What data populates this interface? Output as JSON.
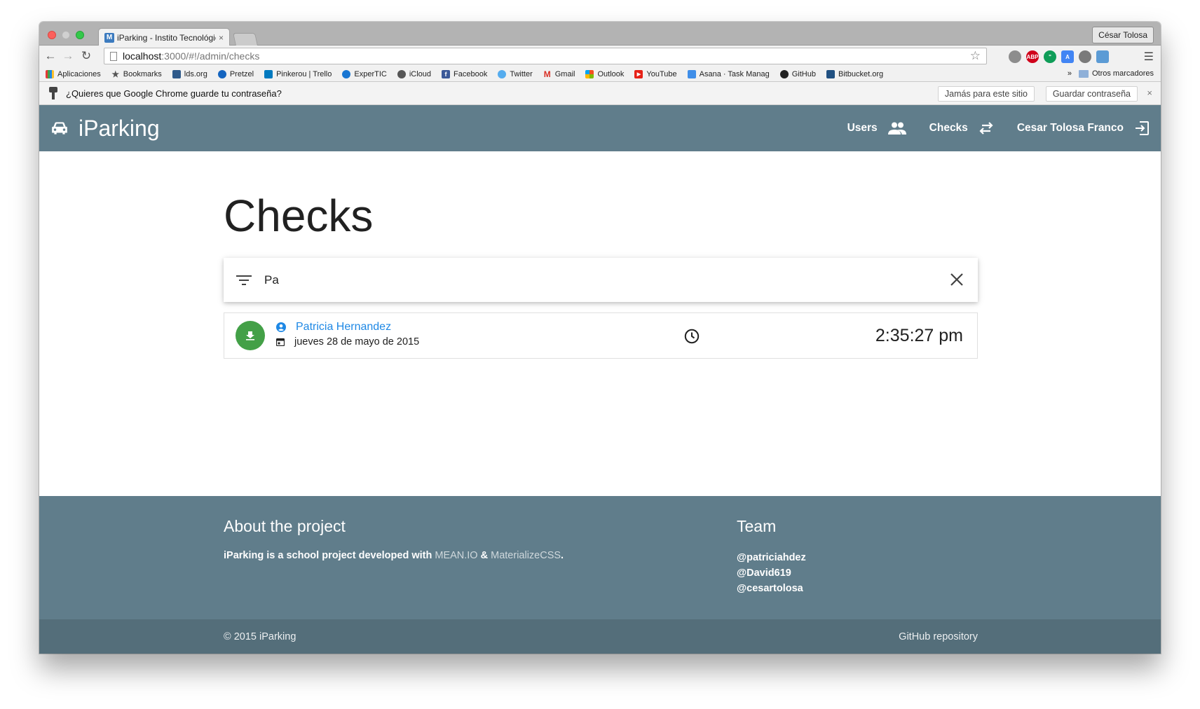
{
  "browser": {
    "tab_title": "iParking - Instito Tecnológico",
    "tab_close": "×",
    "tab_favicon": "M",
    "profile": "César Tolosa",
    "url_host": "localhost",
    "url_path": ":3000/#!/admin/checks",
    "extensions": [
      {
        "name": "abp-icon",
        "label": "ABP",
        "color": "#d0021b"
      },
      {
        "name": "hangouts-icon",
        "label": "\"",
        "color": "#0f9d58"
      },
      {
        "name": "translate-icon",
        "label": "A",
        "color": "#4285f4"
      }
    ],
    "bookmarks": [
      {
        "label": "Aplicaciones",
        "icon": "apps-grid-icon",
        "color": "#e53935"
      },
      {
        "label": "Bookmarks",
        "icon": "star-icon",
        "color": "#555555"
      },
      {
        "label": "lds.org",
        "icon": "lds-icon",
        "color": "#2f5a8a"
      },
      {
        "label": "Pretzel",
        "icon": "pretzel-icon",
        "color": "#1565c0"
      },
      {
        "label": "Pinkerou | Trello",
        "icon": "trello-icon",
        "color": "#0079bf"
      },
      {
        "label": "ExperTIC",
        "icon": "expertic-icon",
        "color": "#1976d2"
      },
      {
        "label": "iCloud",
        "icon": "apple-icon",
        "color": "#555555"
      },
      {
        "label": "Facebook",
        "icon": "facebook-icon",
        "color": "#3b5998"
      },
      {
        "label": "Twitter",
        "icon": "twitter-icon",
        "color": "#55acee"
      },
      {
        "label": "Gmail",
        "icon": "gmail-icon",
        "color": "#d93025"
      },
      {
        "label": "Outlook",
        "icon": "outlook-icon",
        "color": "#f4511e"
      },
      {
        "label": "YouTube",
        "icon": "youtube-icon",
        "color": "#e62117"
      },
      {
        "label": "Asana · Task Manag",
        "icon": "asana-icon",
        "color": "#3f8ee8"
      },
      {
        "label": "GitHub",
        "icon": "github-icon",
        "color": "#222222"
      },
      {
        "label": "Bitbucket.org",
        "icon": "bitbucket-icon",
        "color": "#205081"
      }
    ],
    "bookmarks_more": "»",
    "other_bookmarks": "Otros marcadores",
    "infobar": {
      "message": "¿Quieres que Google Chrome guarde tu contraseña?",
      "never_btn": "Jamás para este sitio",
      "save_btn": "Guardar contraseña",
      "close": "×"
    }
  },
  "app": {
    "brand": "iParking",
    "nav": {
      "users": "Users",
      "checks": "Checks",
      "user_name": "Cesar Tolosa Franco"
    },
    "colors": {
      "primary": "#607d8b",
      "accent": "#43a047",
      "link": "#1e88e5"
    }
  },
  "main": {
    "title": "Checks",
    "search": {
      "value": "Pa"
    },
    "checks": [
      {
        "user": "Patricia Hernandez",
        "date": "jueves 28 de mayo de 2015",
        "time": "2:35:27 pm",
        "type_icon": "download-icon"
      }
    ]
  },
  "footer": {
    "about_title": "About the project",
    "about_prefix": "iParking is a school project developed with ",
    "about_link1": "MEAN.IO",
    "about_amp": " & ",
    "about_link2": "MaterializeCSS",
    "about_suffix": ".",
    "team_title": "Team",
    "team": [
      "@patriciahdez",
      "@David619",
      "@cesartolosa"
    ],
    "copyright": "© 2015 iParking",
    "github_repo": "GitHub repository"
  }
}
